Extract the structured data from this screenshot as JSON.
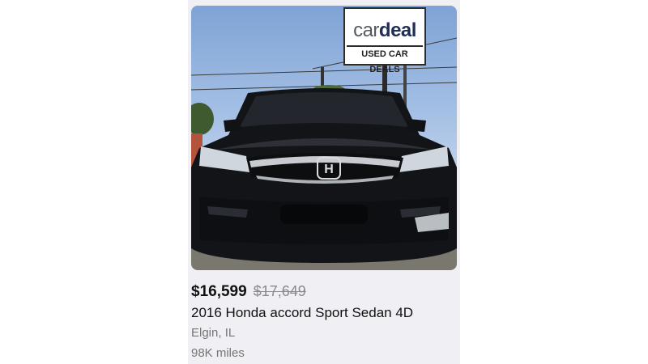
{
  "listing": {
    "price": "$16,599",
    "original_price": "$17,649",
    "title": "2016 Honda accord Sport Sedan 4D",
    "location": "Elgin, IL",
    "mileage": "98K miles",
    "photo": {
      "sign_brand_part1": "car",
      "sign_brand_part2": "deal",
      "sign_subtitle": "USED CAR DEALS",
      "car_color": "#15181c",
      "sky_color": "#8fb1de"
    }
  }
}
